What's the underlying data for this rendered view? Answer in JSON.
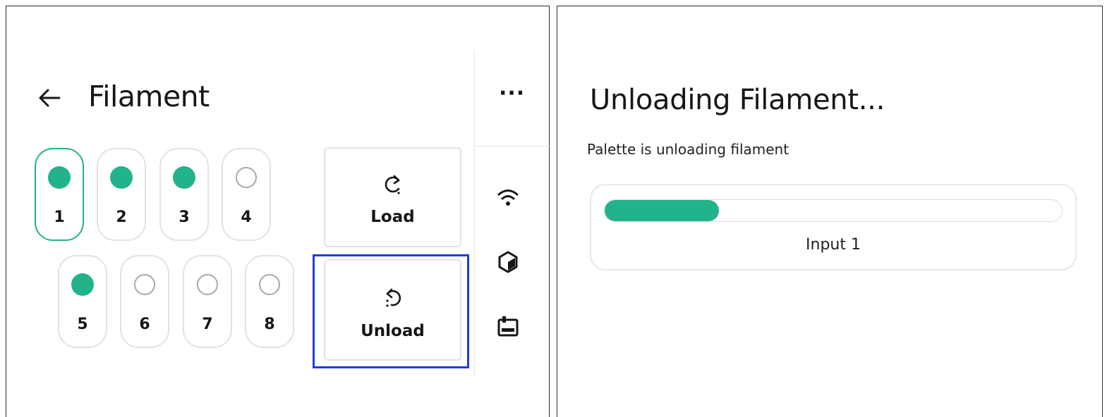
{
  "filament_screen": {
    "title": "Filament",
    "more_label": "···",
    "inputs": [
      {
        "number": "1",
        "state": "loaded",
        "selected": true
      },
      {
        "number": "2",
        "state": "loaded",
        "selected": false
      },
      {
        "number": "3",
        "state": "loaded",
        "selected": false
      },
      {
        "number": "4",
        "state": "empty",
        "selected": false
      },
      {
        "number": "5",
        "state": "loaded",
        "selected": false
      },
      {
        "number": "6",
        "state": "empty",
        "selected": false
      },
      {
        "number": "7",
        "state": "empty",
        "selected": false
      },
      {
        "number": "8",
        "state": "empty",
        "selected": false
      }
    ],
    "load_label": "Load",
    "unload_label": "Unload",
    "side_icons": [
      "wifi-icon",
      "cube-icon",
      "printer-icon"
    ]
  },
  "unloading_screen": {
    "title": "Unloading Filament...",
    "subtitle": "Palette is unloading filament",
    "progress_fraction": 0.25,
    "input_label": "Input 1"
  },
  "colors": {
    "accent": "#22b38a",
    "highlight": "#1f3ed6",
    "border": "#e2e2e2"
  }
}
